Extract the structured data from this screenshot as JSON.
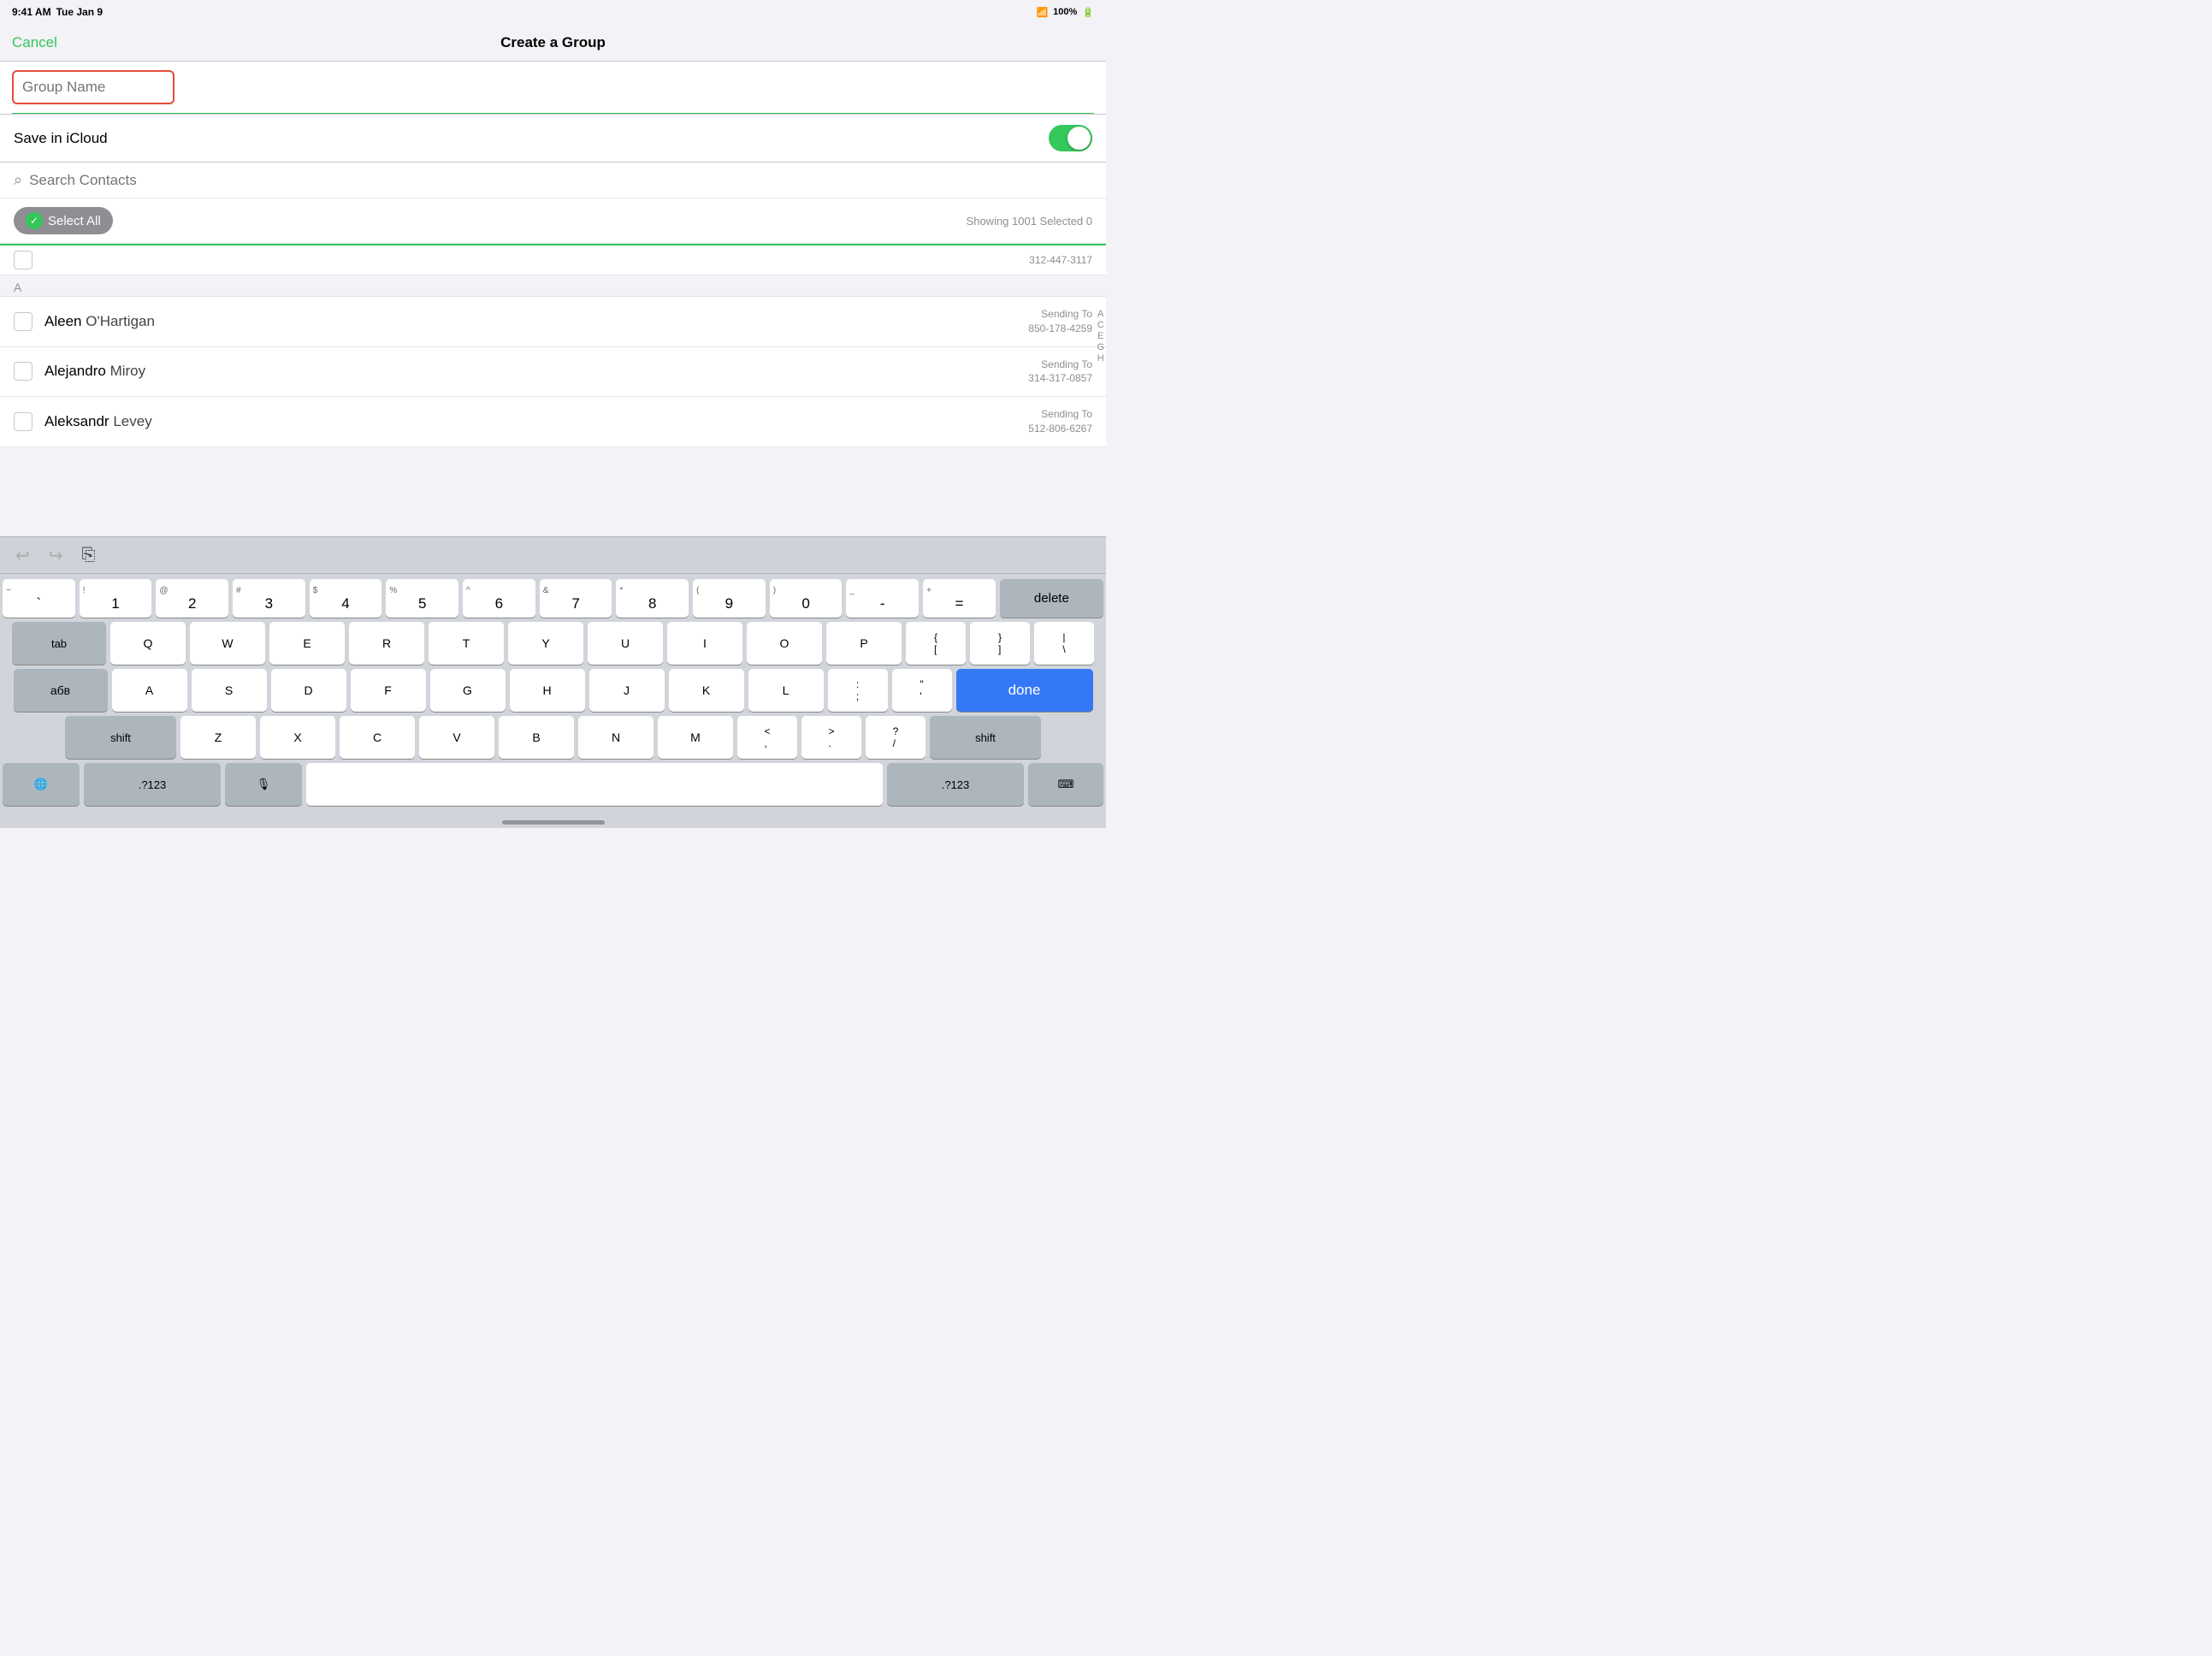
{
  "status": {
    "time": "9:41 AM",
    "day": "Tue Jan 9",
    "wifi": "WiFi",
    "battery": "100%"
  },
  "nav": {
    "cancel_label": "Cancel",
    "title": "Create a Group"
  },
  "group_name": {
    "placeholder": "Group Name"
  },
  "icloud": {
    "label": "Save in iCloud"
  },
  "search": {
    "placeholder": "Search Contacts"
  },
  "select_all": {
    "label": "Select All",
    "showing": "Showing 1001  Selected 0"
  },
  "contacts": {
    "section_label": "A",
    "items": [
      {
        "first": "Aleen",
        "last": "O'Hartigan",
        "meta1": "Sending To",
        "meta2": "850-178-4259"
      },
      {
        "first": "Alejandro",
        "last": "Miroy",
        "meta1": "Sending To",
        "meta2": "314-317-0857"
      },
      {
        "first": "Aleksandr",
        "last": "Levey",
        "meta1": "Sending To",
        "meta2": "512-806-6267"
      }
    ],
    "partial_above": "312-447-3117"
  },
  "index_letters": [
    "A",
    "C",
    "E",
    "G",
    "H"
  ],
  "keyboard": {
    "toolbar_undo": "↩",
    "toolbar_redo": "↪",
    "toolbar_paste": "📋",
    "num_row": [
      {
        "top": "~",
        "main": "`"
      },
      {
        "top": "!",
        "main": "1"
      },
      {
        "top": "@",
        "main": "2"
      },
      {
        "top": "#",
        "main": "3"
      },
      {
        "top": "$",
        "main": "4"
      },
      {
        "top": "%",
        "main": "5"
      },
      {
        "top": "^",
        "main": "6"
      },
      {
        "top": "&",
        "main": "7"
      },
      {
        "top": "*",
        "main": "8"
      },
      {
        "top": "(",
        "main": "9"
      },
      {
        "top": ")",
        "main": "0"
      },
      {
        "top": "_",
        "main": "-"
      },
      {
        "top": "+",
        "main": "="
      }
    ],
    "delete_label": "delete",
    "tab_label": "tab",
    "qwerty": [
      "Q",
      "W",
      "E",
      "R",
      "T",
      "Y",
      "U",
      "I",
      "O",
      "P"
    ],
    "lbracket": "{  [",
    "rbracket": "}  ]",
    "pipe": "|  \\",
    "abv_label": "абв",
    "asdf": [
      "A",
      "S",
      "D",
      "F",
      "G",
      "H",
      "J",
      "K",
      "L"
    ],
    "colon": ":  ;",
    "quote": "\"  '",
    "done_label": "done",
    "shift_label": "shift",
    "zxcv": [
      "Z",
      "X",
      "C",
      "V",
      "B",
      "N",
      "M"
    ],
    "lt": "<  ,",
    "gt": ">  .",
    "qmark": "?  /",
    "shift_right_label": "shift",
    "globe_label": "🌐",
    "punct_label": ".?123",
    "mic_label": "🎙",
    "space_label": "",
    "punct_right_label": ".?123",
    "kbd_label": "⌨"
  }
}
